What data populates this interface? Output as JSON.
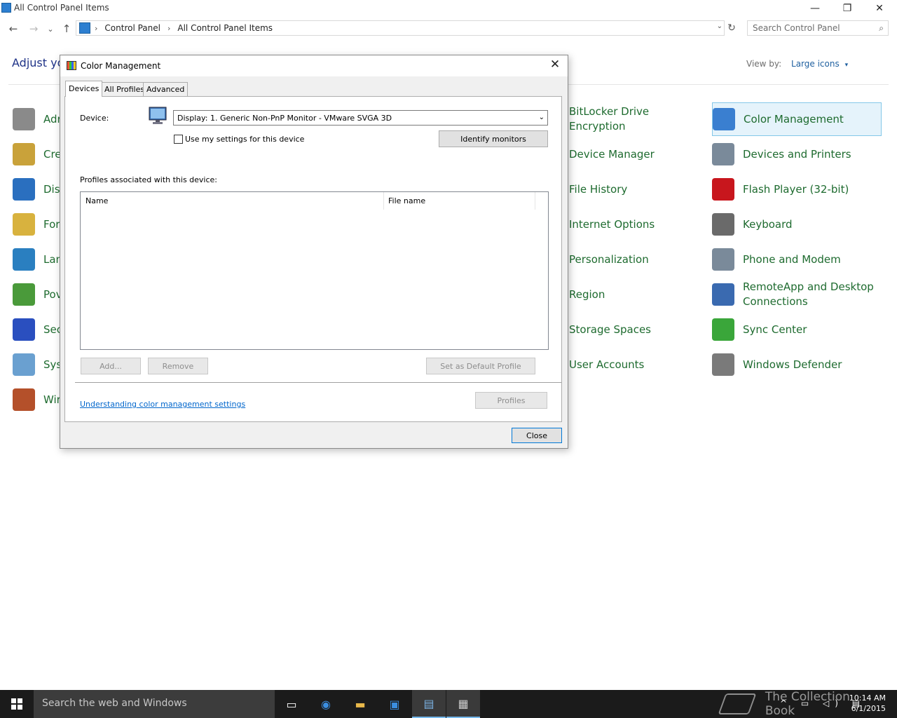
{
  "window": {
    "title": "All Control Panel Items",
    "minimize_glyph": "—",
    "restore_glyph": "❐",
    "close_glyph": "✕"
  },
  "address_bar": {
    "back_glyph": "←",
    "forward_glyph": "→",
    "recent_glyph": "⌄",
    "up_glyph": "↑",
    "separator_glyph": "›",
    "crumbs": [
      "Control Panel",
      "All Control Panel Items"
    ],
    "dropdown_glyph": "⌄",
    "refresh_glyph": "↻",
    "search_placeholder": "Search Control Panel",
    "search_glyph": "⌕"
  },
  "content": {
    "heading": "Adjust yo",
    "view_by_label": "View by:",
    "view_by_value": "Large icons",
    "view_by_caret": "▾",
    "left_items": [
      {
        "label": "Adr",
        "icon": "administrative-tools-icon",
        "color": "#8a8a8a"
      },
      {
        "label": "Cre",
        "icon": "credential-manager-icon",
        "color": "#c9a23a"
      },
      {
        "label": "Dis",
        "icon": "display-icon",
        "color": "#2a6fbf"
      },
      {
        "label": "For",
        "icon": "fonts-icon",
        "color": "#d8b23e"
      },
      {
        "label": "Lan",
        "icon": "language-icon",
        "color": "#2a7fc0"
      },
      {
        "label": "Pov",
        "icon": "power-options-icon",
        "color": "#4a9a3a"
      },
      {
        "label": "Sec",
        "icon": "security-maintenance-icon",
        "color": "#2a4fbf"
      },
      {
        "label": "Sys",
        "icon": "system-icon",
        "color": "#6aa0d0"
      },
      {
        "label": "Wir",
        "icon": "windows-firewall-icon",
        "color": "#b4502a"
      }
    ],
    "middle_items": [
      {
        "label": "BitLocker Drive Encryption"
      },
      {
        "label": "Device Manager"
      },
      {
        "label": "File History"
      },
      {
        "label": "Internet Options"
      },
      {
        "label": "Personalization"
      },
      {
        "label": "Region"
      },
      {
        "label": "Storage Spaces"
      },
      {
        "label": "User Accounts"
      }
    ],
    "right_items": [
      {
        "label": "Color Management",
        "icon": "color-management-icon",
        "color": "#3a7fd0",
        "selected": true
      },
      {
        "label": "Devices and Printers",
        "icon": "devices-printers-icon",
        "color": "#7a8a9a"
      },
      {
        "label": "Flash Player (32-bit)",
        "icon": "flash-player-icon",
        "color": "#c8161d"
      },
      {
        "label": "Keyboard",
        "icon": "keyboard-icon",
        "color": "#6a6a6a"
      },
      {
        "label": "Phone and Modem",
        "icon": "phone-modem-icon",
        "color": "#7a8a9a"
      },
      {
        "label": "RemoteApp and Desktop Connections",
        "icon": "remoteapp-icon",
        "color": "#3a6ab0"
      },
      {
        "label": "Sync Center",
        "icon": "sync-center-icon",
        "color": "#3aa63a"
      },
      {
        "label": "Windows Defender",
        "icon": "windows-defender-icon",
        "color": "#7a7a7a"
      }
    ]
  },
  "dialog": {
    "title": "Color Management",
    "close_glyph": "✕",
    "tabs": [
      "Devices",
      "All Profiles",
      "Advanced"
    ],
    "device_label": "Device:",
    "device_value": "Display: 1. Generic Non-PnP Monitor - VMware SVGA 3D",
    "device_caret": "⌄",
    "use_settings_label": "Use my settings for this device",
    "use_settings_checked": false,
    "identify_button": "Identify monitors",
    "profiles_label": "Profiles associated with this device:",
    "columns": [
      "Name",
      "File name"
    ],
    "rows": [],
    "add_button": "Add...",
    "remove_button": "Remove",
    "set_default_button": "Set as Default Profile",
    "link_text": "Understanding color management settings",
    "profiles_button": "Profiles",
    "close_button": "Close"
  },
  "taskbar": {
    "search_placeholder": "Search the web and Windows",
    "time": "10:14 AM",
    "date": "6/1/2015",
    "watermark": "The Collection Book",
    "tray_glyphs": "^ ▭ ◁) ▤",
    "apps": [
      {
        "name": "task-view",
        "glyph": "▭",
        "color": "#ffffff"
      },
      {
        "name": "edge",
        "glyph": "◉",
        "color": "#3b8ee0"
      },
      {
        "name": "file-explorer",
        "glyph": "▬",
        "color": "#e8b84a"
      },
      {
        "name": "store",
        "glyph": "▣",
        "color": "#3b8ee0"
      },
      {
        "name": "control-panel",
        "glyph": "▤",
        "color": "#7ab0e0"
      },
      {
        "name": "color-management",
        "glyph": "▦",
        "color": "#cccccc"
      }
    ]
  },
  "colors": {
    "link_green": "#1e6b2f",
    "heading_blue": "#1e3287",
    "selection_bg": "#e5f3fb",
    "selection_border": "#84c7e8",
    "taskbar_bg": "#1b1b1b",
    "accent": "#0078d7"
  }
}
